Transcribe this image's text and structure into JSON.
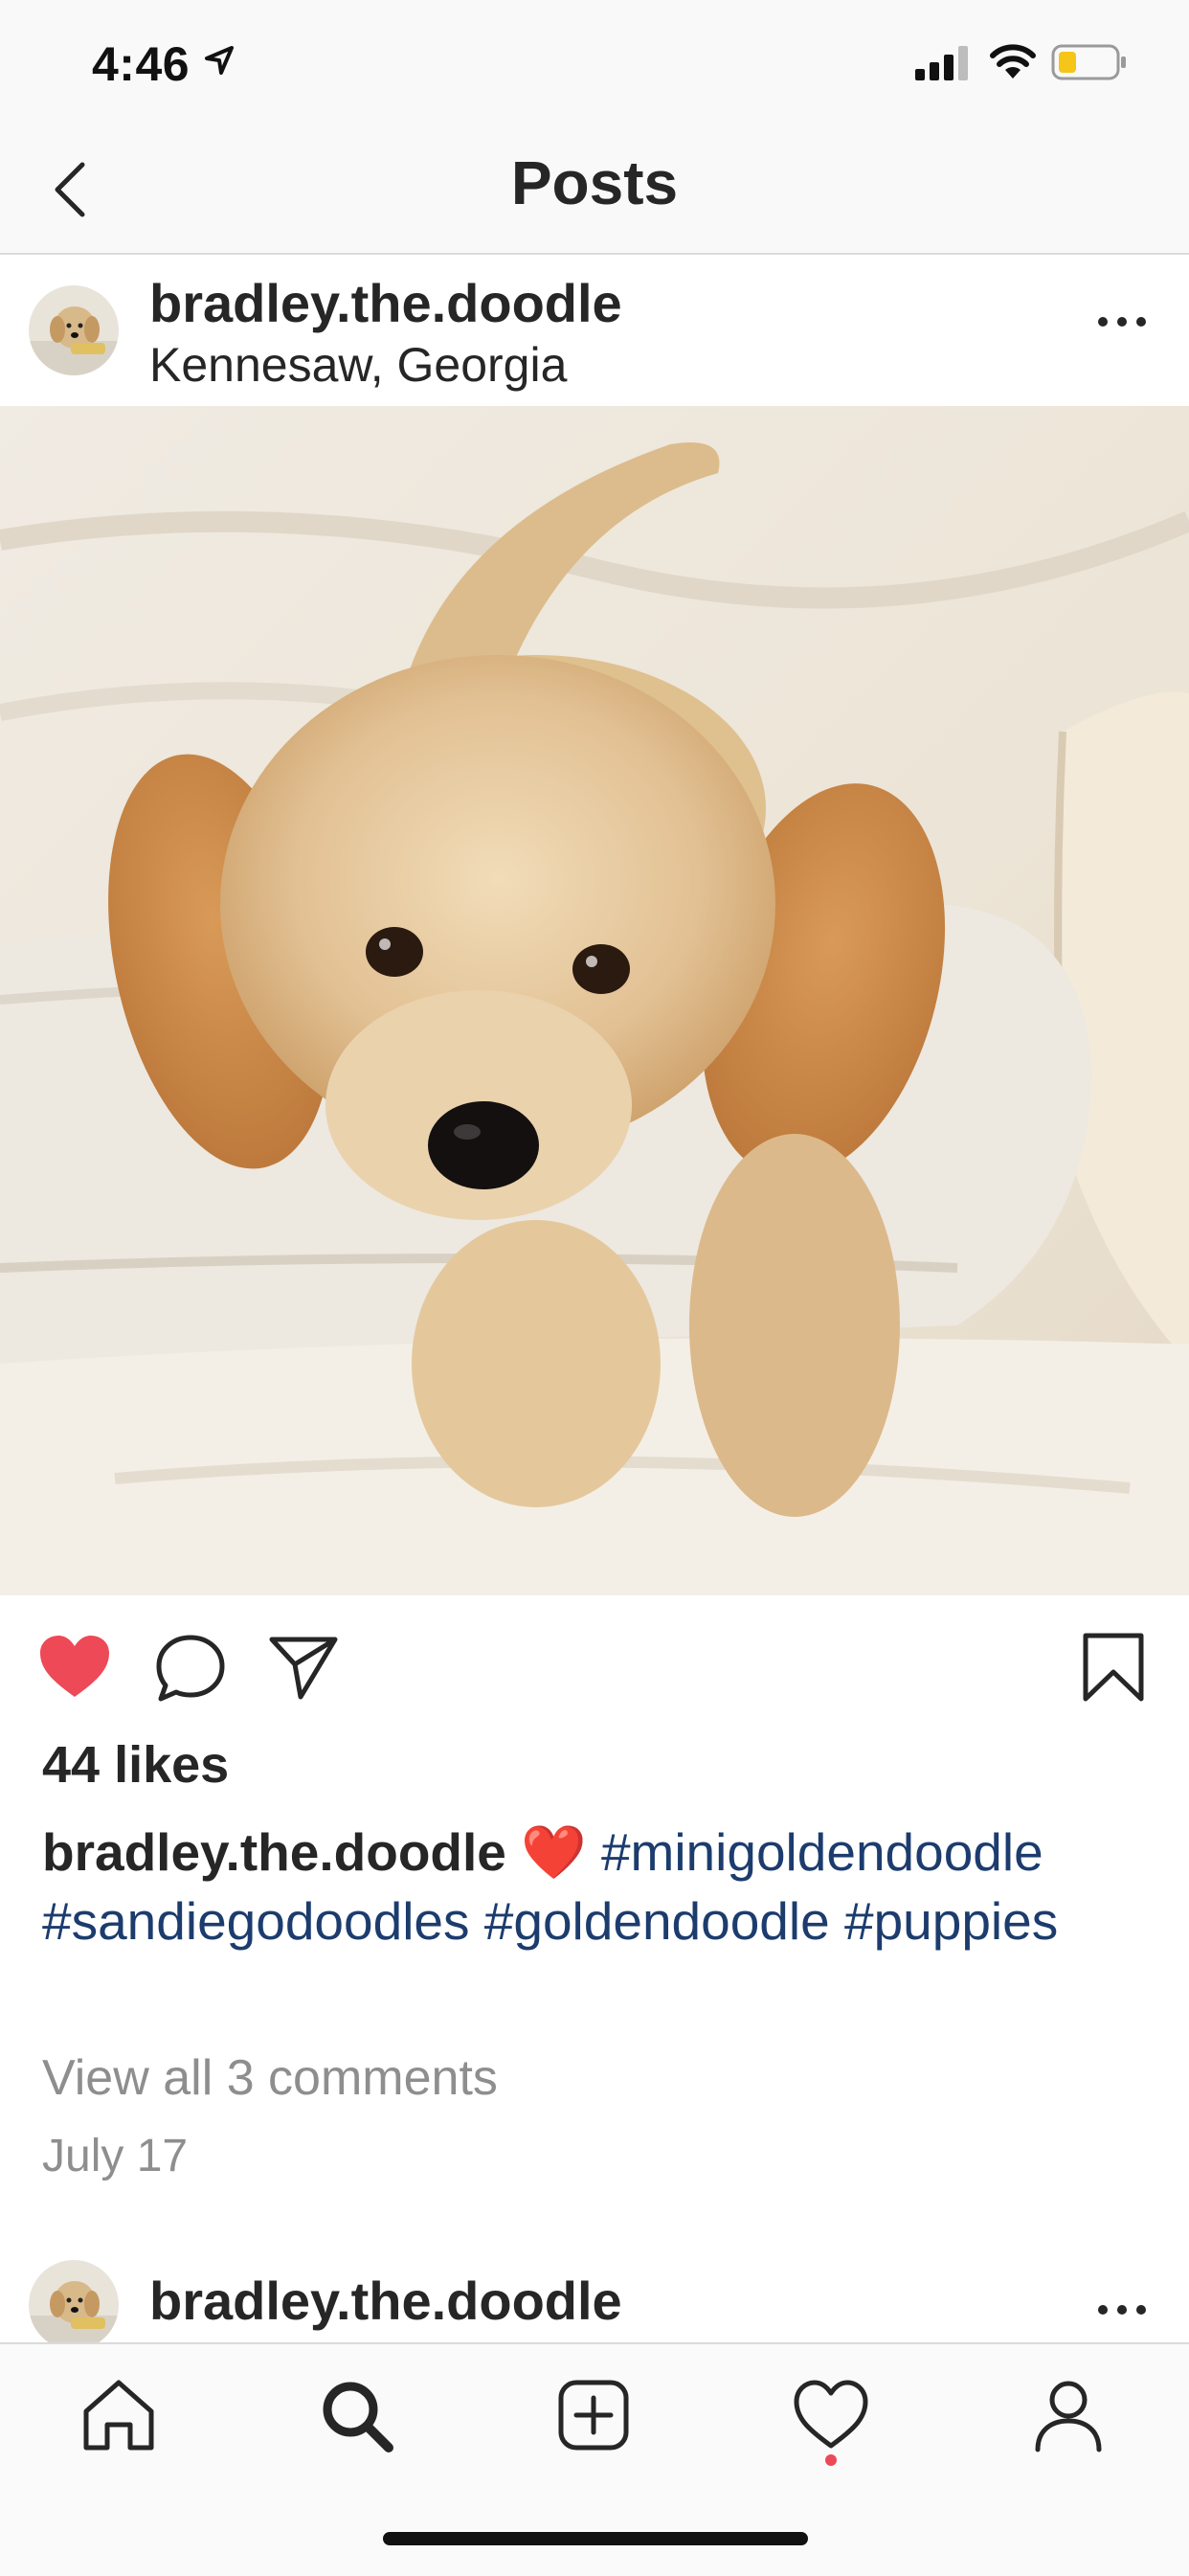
{
  "status": {
    "time": "4:46"
  },
  "header": {
    "title": "Posts"
  },
  "post": {
    "username": "bradley.the.doodle",
    "location": "Kennesaw, Georgia",
    "likes": "44 likes",
    "caption_user": "bradley.the.doodle",
    "caption_emoji": "❤️",
    "hashtags": [
      "#minigoldendoodle",
      "#sandiegodoodles",
      "#goldendoodle",
      "#puppies"
    ],
    "view_comments": "View all 3 comments",
    "date": "July 17",
    "liked": true
  },
  "next_post": {
    "username": "bradley.the.doodle"
  },
  "tabs": [
    {
      "name": "home-icon"
    },
    {
      "name": "search-icon"
    },
    {
      "name": "add-post-icon"
    },
    {
      "name": "activity-heart-icon"
    },
    {
      "name": "profile-icon"
    }
  ],
  "colors": {
    "like_red": "#ed4956",
    "hashtag_blue": "#1c3c6e",
    "muted": "#8e8e8e"
  }
}
